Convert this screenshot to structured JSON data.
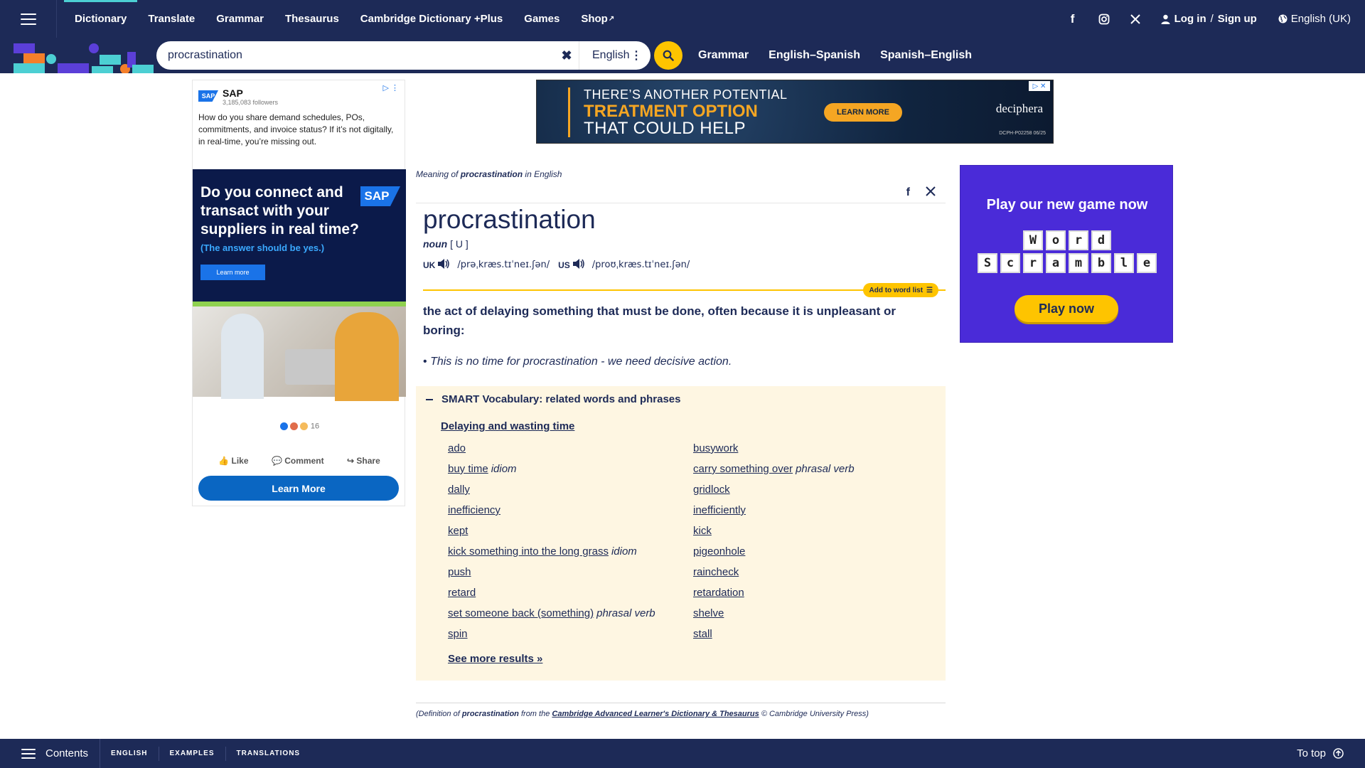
{
  "topnav": {
    "links": [
      "Dictionary",
      "Translate",
      "Grammar",
      "Thesaurus",
      "Cambridge Dictionary +Plus",
      "Games",
      "Shop"
    ],
    "social": [
      "f",
      "instagram",
      "X"
    ],
    "login": "Log in",
    "slash": "/",
    "signup": "Sign up",
    "language": "English (UK)"
  },
  "search": {
    "query": "procrastination",
    "dictionary": "English",
    "links": [
      "Grammar",
      "English–Spanish",
      "Spanish–English"
    ]
  },
  "left_ad": {
    "brand": "SAP",
    "followers": "3,185,083 followers",
    "body": "How do you share demand schedules, POs, commitments, and invoice status? If it’s not digitally, in real-time, you’re missing out.",
    "headline": "Do you connect and transact with your suppliers in real time?",
    "sub": "(The answer should be yes.)",
    "learn_small": "Learn more",
    "reaction_count": "16",
    "actions": [
      "Like",
      "Comment",
      "Share"
    ],
    "cta": "Learn More"
  },
  "top_ad": {
    "line1": "THERE’S ANOTHER POTENTIAL",
    "line2": "TREATMENT OPTION",
    "line3": "THAT COULD HELP",
    "cta": "LEARN MORE",
    "brand": "deciphera",
    "code": "DCPH-P02258 06/25"
  },
  "entry": {
    "meaning_prefix": "Meaning of",
    "meaning_word": "procrastination",
    "meaning_suffix": "in English",
    "headword": "procrastination",
    "pos": "noun",
    "grammar": "[ U ]",
    "uk_label": "UK",
    "uk_ipa": "/prəˌkræs.tɪˈneɪ.ʃən/",
    "us_label": "US",
    "us_ipa": "/proʊˌkræs.tɪˈneɪ.ʃən/",
    "add_to_list": "Add to word list",
    "definition": "the act of delaying something that must be done, often because it is unpleasant or boring:",
    "example": "This is no time for procrastination - we need decisive action."
  },
  "smart": {
    "heading": "SMART Vocabulary: related words and phrases",
    "topic": "Delaying and wasting time",
    "left": [
      {
        "word": "ado",
        "tag": ""
      },
      {
        "word": "buy time",
        "tag": "idiom"
      },
      {
        "word": "dally",
        "tag": ""
      },
      {
        "word": "inefficiency",
        "tag": ""
      },
      {
        "word": "kept",
        "tag": ""
      },
      {
        "word": "kick something into the long grass",
        "tag": "idiom"
      },
      {
        "word": "push",
        "tag": ""
      },
      {
        "word": "retard",
        "tag": ""
      },
      {
        "word": "set someone back (something)",
        "tag": "phrasal verb"
      },
      {
        "word": "spin",
        "tag": ""
      }
    ],
    "right": [
      {
        "word": "busywork",
        "tag": ""
      },
      {
        "word": "carry something over",
        "tag": "phrasal verb"
      },
      {
        "word": "gridlock",
        "tag": ""
      },
      {
        "word": "inefficiently",
        "tag": ""
      },
      {
        "word": "kick",
        "tag": ""
      },
      {
        "word": "pigeonhole",
        "tag": ""
      },
      {
        "word": "raincheck",
        "tag": ""
      },
      {
        "word": "retardation",
        "tag": ""
      },
      {
        "word": "shelve",
        "tag": ""
      },
      {
        "word": "stall",
        "tag": ""
      }
    ],
    "see_more": "See more results »"
  },
  "source": {
    "prefix": "(Definition of",
    "word": "procrastination",
    "mid": "from the",
    "book": "Cambridge Advanced Learner's Dictionary & Thesaurus",
    "suffix": "© Cambridge University Press)"
  },
  "right_ad": {
    "title": "Play our new game now",
    "row1": [
      "W",
      "o",
      "r",
      "d"
    ],
    "row2": [
      "S",
      "c",
      "r",
      "a",
      "m",
      "b",
      "l",
      "e"
    ],
    "cta": "Play now"
  },
  "bottombar": {
    "contents": "Contents",
    "tabs": [
      "ENGLISH",
      "EXAMPLES",
      "TRANSLATIONS"
    ],
    "to_top": "To top"
  },
  "colors": {
    "navy": "#1d2a57",
    "yellow": "#fec400",
    "cyan": "#4ccfd3",
    "smart_bg": "#fef6e2",
    "game_purple": "#4a2bd8"
  }
}
